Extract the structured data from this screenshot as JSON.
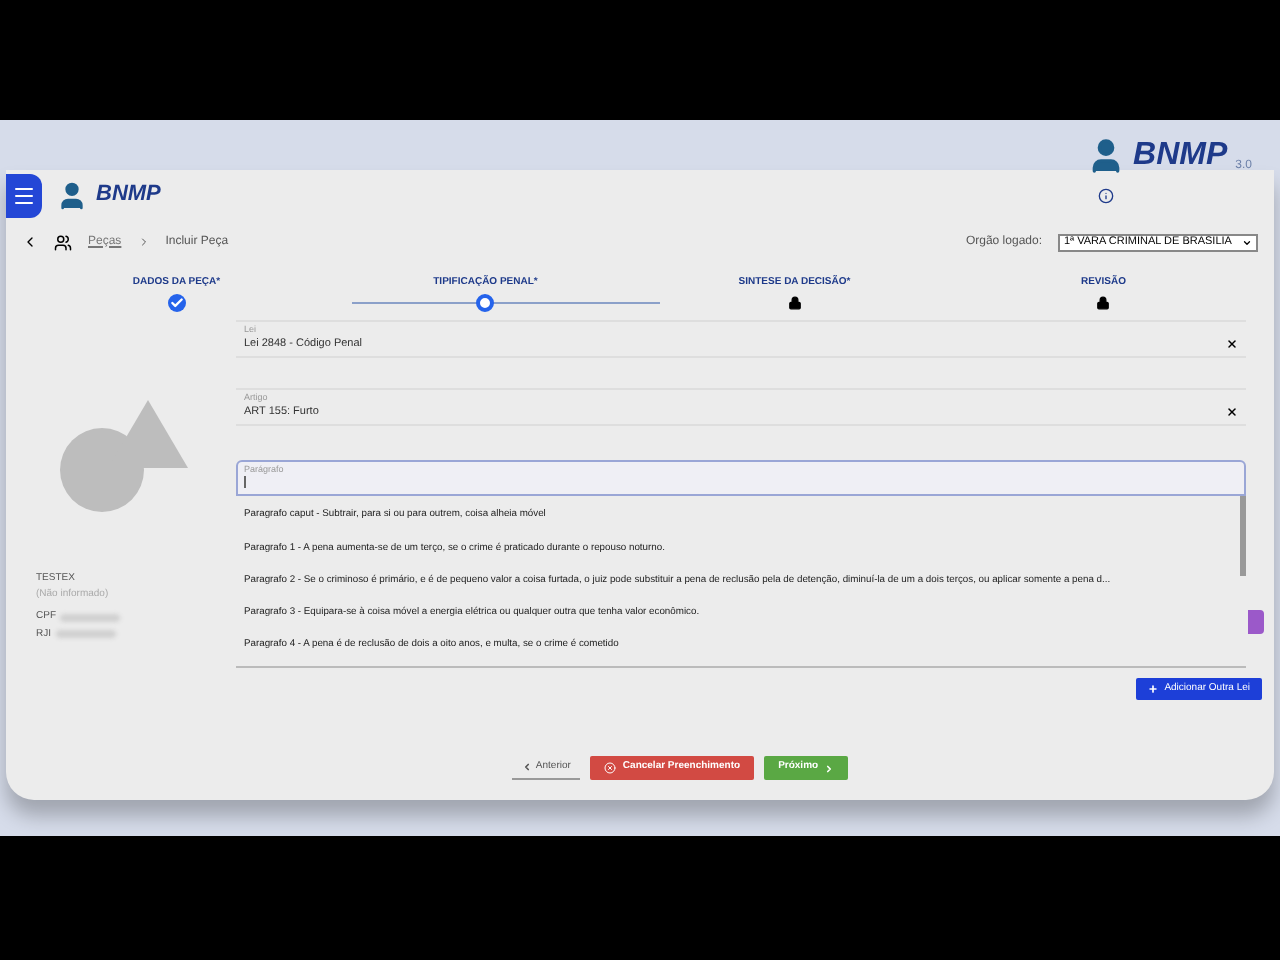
{
  "header": {
    "logo_text": "BNMP",
    "corner_logo_text": "BNMP",
    "corner_logo_version": "3.0"
  },
  "breadcrumb": {
    "items": [
      "Peças",
      "Incluir Peça"
    ]
  },
  "orgao": {
    "label": "Orgão logado:",
    "value": "1ª VARA CRIMINAL DE BRASILIA"
  },
  "steps": [
    {
      "label": "DADOS DA PEÇA*",
      "kind": "done"
    },
    {
      "label": "TIPIFICAÇÃO PENAL*",
      "kind": "current"
    },
    {
      "label": "SINTESE DA DECISÃO*",
      "kind": "locked"
    },
    {
      "label": "REVISÃO",
      "kind": "locked"
    }
  ],
  "person": {
    "name": "TESTEX",
    "subtitle": "(Não informado)",
    "fields": [
      {
        "label": "CPF"
      },
      {
        "label": "RJI"
      }
    ]
  },
  "fields": [
    {
      "label": "Lei",
      "value": "Lei 2848 - Código Penal"
    },
    {
      "label": "Artigo",
      "value": "ART 155: Furto"
    }
  ],
  "paragrafo": {
    "label": "Parágrafo",
    "focused": true
  },
  "options": [
    "Paragrafo caput - Subtrair, para si ou para outrem, coisa alheia móvel",
    "Paragrafo 1 - A pena aumenta-se de um terço, se o crime é praticado durante o repouso noturno.",
    "Paragrafo 2 - Se o criminoso é primário, e é de pequeno valor a coisa furtada, o juiz pode substituir a pena de reclusão pela de detenção, diminuí-la de um a dois terços, ou aplicar somente a pena d...",
    "Paragrafo 3 - Equipara-se à coisa móvel a energia elétrica ou qualquer outra que tenha valor econômico.",
    "Paragrafo 4 - A pena é de reclusão de dois a oito anos, e multa, se o crime é cometido"
  ],
  "add_button": "Adicionar Outra Lei",
  "nav": [
    {
      "kind": "back",
      "label": "Anterior"
    },
    {
      "kind": "cancel",
      "label": "Cancelar Preenchimento"
    },
    {
      "kind": "next",
      "label": "Próximo"
    }
  ]
}
